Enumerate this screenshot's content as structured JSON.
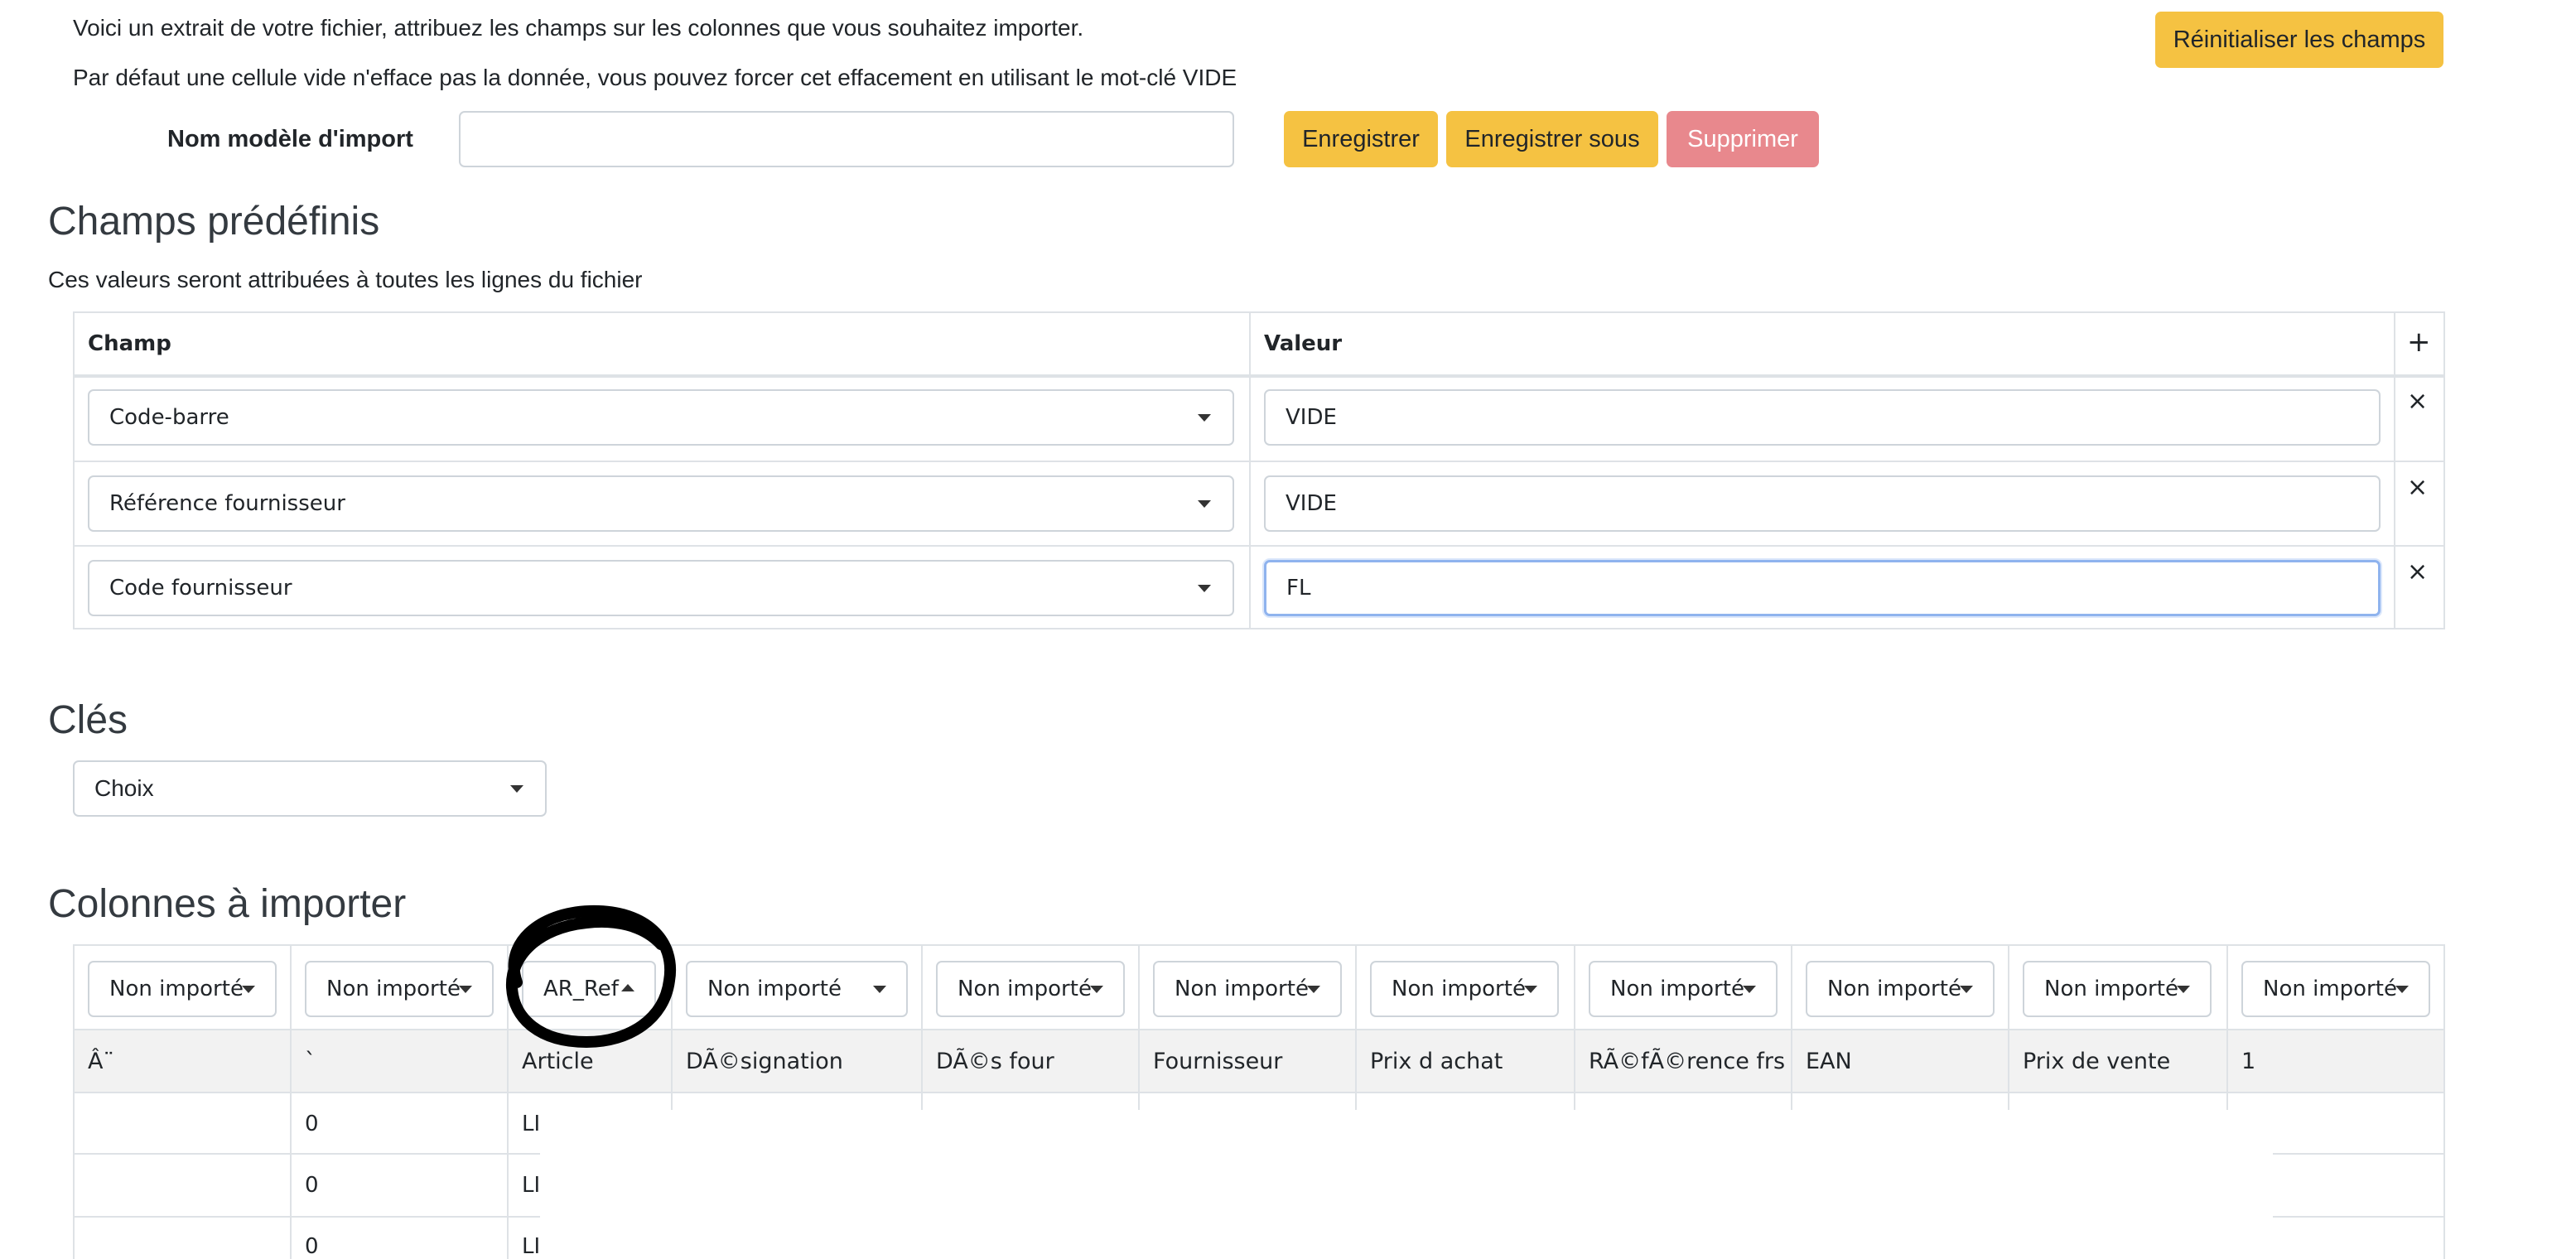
{
  "intro": {
    "line1": "Voici un extrait de votre fichier, attribuez les champs sur les colonnes que vous souhaitez importer.",
    "line2": "Par défaut une cellule vide n'efface pas la donnée, vous pouvez forcer cet effacement en utilisant le mot-clé VIDE"
  },
  "reset_button": "Réinitialiser les champs",
  "template": {
    "label": "Nom modèle d'import",
    "value": "",
    "save": "Enregistrer",
    "save_as": "Enregistrer sous",
    "delete": "Supprimer"
  },
  "predefined": {
    "title": "Champs prédéfinis",
    "subtitle": "Ces valeurs seront attribuées à toutes les lignes du fichier",
    "header_field": "Champ",
    "header_value": "Valeur",
    "add_icon": "+",
    "remove_icon": "×",
    "rows": [
      {
        "field": "Code-barre",
        "value": "VIDE"
      },
      {
        "field": "Référence fournisseur",
        "value": "VIDE"
      },
      {
        "field": "Code fournisseur",
        "value": "FL"
      }
    ]
  },
  "keys": {
    "title": "Clés",
    "select": "Choix"
  },
  "columns": {
    "title": "Colonnes à importer",
    "selects": [
      "Non importé",
      "Non importé",
      "AR_Ref",
      "Non importé",
      "Non importé",
      "Non importé",
      "Non importé",
      "Non importé",
      "Non importé",
      "Non importé",
      "Non importé"
    ],
    "headers": [
      "Â¨",
      "`",
      "Article",
      "DÃ©signation",
      "DÃ©s four",
      "Fournisseur",
      "Prix d achat",
      "RÃ©fÃ©rence frs",
      "EAN",
      "Prix de vente",
      "1"
    ],
    "rows": [
      [
        "",
        "0",
        "LI"
      ],
      [
        "",
        "0",
        "LI"
      ],
      [
        "",
        "0",
        "LI"
      ]
    ]
  },
  "colors": {
    "primary_button": "#f5c242",
    "danger_button": "#e8888d",
    "annotation": "#000000"
  }
}
